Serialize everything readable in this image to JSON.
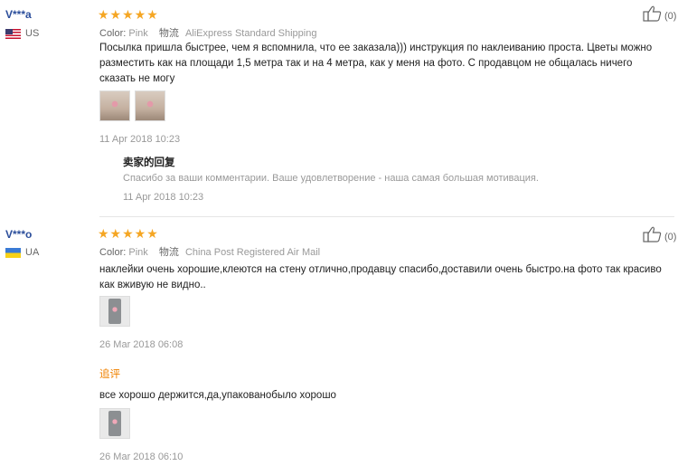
{
  "reviews": [
    {
      "user": "V***a",
      "country": "US",
      "stars": "★★★★★",
      "color_label": "Color:",
      "color_value": "Pink",
      "ship_label": "物流",
      "ship_value": "AliExpress Standard Shipping",
      "text": "Посылка пришла быстрее, чем я вспомнила, что ее заказала))) инструкция по наклеиванию проста. Цветы можно разместить как на площади 1,5 метра так и на 4 метра, как у меня на фото. С продавцом не общалась ничего сказать не могу",
      "date": "11 Apr 2018 10:23",
      "likes": "(0)",
      "seller_reply": {
        "title": "卖家的回复",
        "text": "Спасибо за ваши комментарии. Ваше удовлетворение - наша самая большая мотивация.",
        "date": "11 Apr 2018 10:23"
      }
    },
    {
      "user": "V***o",
      "country": "UA",
      "stars": "★★★★★",
      "color_label": "Color:",
      "color_value": "Pink",
      "ship_label": "物流",
      "ship_value": "China Post Registered Air Mail",
      "text": "наклейки очень хорошие,клеются на стену отлично,продавцу спасибо,доставили очень быстро.на фото так красиво как вживую не видно..",
      "date": "26 Mar 2018 06:08",
      "likes": "(0)",
      "followup": {
        "title": "追评",
        "text": "все хорошо держится,да,упакованобыло хорошо",
        "date": "26 Mar 2018 06:10"
      }
    }
  ]
}
